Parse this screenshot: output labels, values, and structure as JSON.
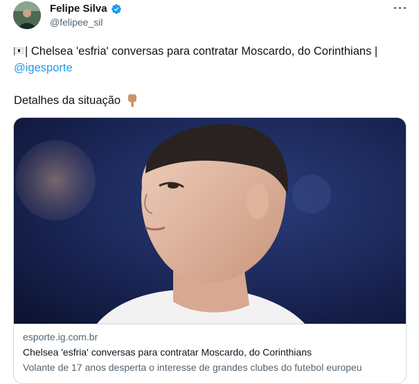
{
  "author": {
    "name": "Felipe Silva",
    "handle": "@felipee_sil",
    "avatar_icon": "avatar-photo",
    "verified_color": "#1d9bf0"
  },
  "tweet": {
    "flag_icon": "corinthians-flag-icon",
    "text_main": "| Chelsea 'esfria' conversas para contratar Moscardo, do Corinthians |",
    "link": "@igesporte",
    "details": "Detalhes da situação",
    "pointer_icon": "pointing-down-hand-icon"
  },
  "card": {
    "domain": "esporte.ig.com.br",
    "title": "Chelsea 'esfria' conversas para contratar Moscardo, do Corinthians",
    "description": "Volante de 17 anos desperta o interesse de grandes clubes do futebol europeu"
  },
  "colors": {
    "link": "#1d9bf0",
    "secondary_text": "#536471",
    "border": "#cfd9de"
  }
}
